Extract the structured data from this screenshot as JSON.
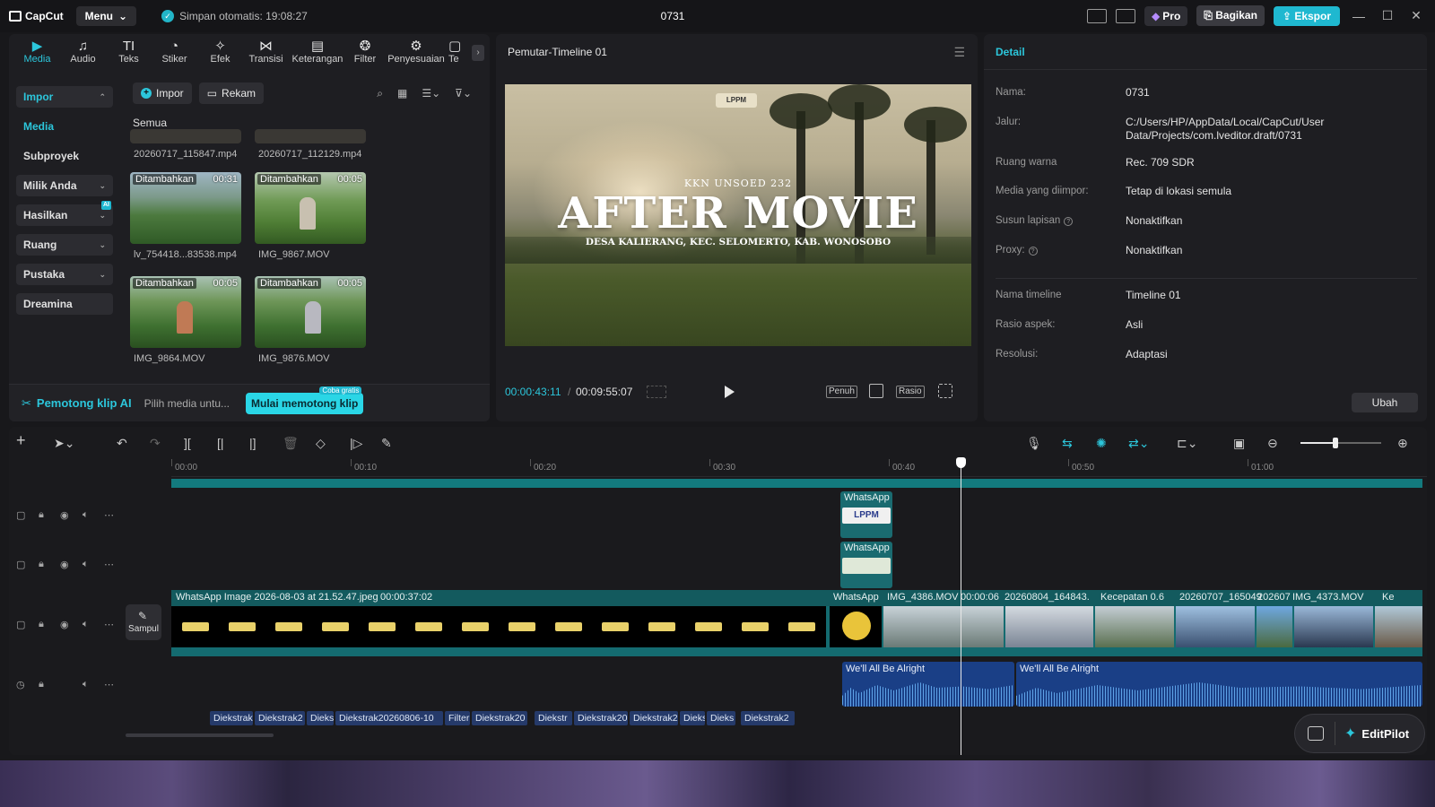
{
  "app": {
    "brand": "CapCut",
    "menu_label": "Menu",
    "autosave": "Simpan otomatis: 19:08:27",
    "project_title": "0731",
    "pro_label": "Pro",
    "share_label": "Bagikan",
    "export_label": "Ekspor"
  },
  "tool_tabs": [
    {
      "label": "Media",
      "icon": "media-icon"
    },
    {
      "label": "Audio",
      "icon": "audio-icon"
    },
    {
      "label": "Teks",
      "icon": "text-icon"
    },
    {
      "label": "Stiker",
      "icon": "sticker-icon"
    },
    {
      "label": "Efek",
      "icon": "effect-icon"
    },
    {
      "label": "Transisi",
      "icon": "transition-icon"
    },
    {
      "label": "Keterangan",
      "icon": "caption-icon"
    },
    {
      "label": "Filter",
      "icon": "filter-icon"
    },
    {
      "label": "Penyesuaian",
      "icon": "adjust-icon"
    },
    {
      "label": "Te",
      "icon": "template-icon"
    }
  ],
  "side_nav": {
    "impor": "Impor",
    "media": "Media",
    "subproyek": "Subproyek",
    "milik_anda": "Milik Anda",
    "hasilkan": "Hasilkan",
    "ai_badge": "AI",
    "ruang": "Ruang",
    "pustaka": "Pustaka",
    "dreamina": "Dreamina"
  },
  "media_toolbar": {
    "import_label": "Impor",
    "record_label": "Rekam"
  },
  "media": {
    "filter_label": "Semua",
    "items": [
      {
        "name": "20260717_115847.mp4",
        "added": "",
        "duration": ""
      },
      {
        "name": "20260717_112129.mp4",
        "added": "",
        "duration": ""
      },
      {
        "name": "lv_754418...83538.mp4",
        "added": "Ditambahkan",
        "duration": "00:31"
      },
      {
        "name": "IMG_9867.MOV",
        "added": "Ditambahkan",
        "duration": "00:05"
      },
      {
        "name": "IMG_9864.MOV",
        "added": "Ditambahkan",
        "duration": "00:05"
      },
      {
        "name": "IMG_9876.MOV",
        "added": "Ditambahkan",
        "duration": "00:05"
      }
    ]
  },
  "ai_bar": {
    "title": "Pemotong klip AI",
    "hint": "Pilih media untu...",
    "start_label": "Mulai memotong klip",
    "try_badge": "Coba gratis"
  },
  "player": {
    "title": "Pemutar-Timeline 01",
    "video_logo": "LPPM",
    "video_kicker": "KKN UNSOED 232",
    "video_title": "AFTER MOVIE",
    "video_subtitle": "DESA KALIERANG, KEC. SELOMERTO, KAB. WONOSOBO",
    "current_time": "00:00:43:11",
    "separator": "/",
    "total_time": "00:09:55:07",
    "full_label": "Penuh",
    "ratio_label": "Rasio"
  },
  "detail": {
    "header": "Detail",
    "rows": [
      {
        "label": "Nama:",
        "value": "0731"
      },
      {
        "label": "Jalur:",
        "value": "C:/Users/HP/AppData/Local/CapCut/User Data/Projects/com.lveditor.draft/0731"
      },
      {
        "label": "Ruang warna",
        "value": "Rec. 709 SDR"
      },
      {
        "label": "Media yang diimpor:",
        "value": "Tetap di lokasi semula"
      },
      {
        "label": "Susun lapisan",
        "value": "Nonaktifkan"
      },
      {
        "label": "Proxy:",
        "value": "Nonaktifkan"
      },
      {
        "label": "Nama timeline",
        "value": "Timeline 01"
      },
      {
        "label": "Rasio aspek:",
        "value": "Asli"
      },
      {
        "label": "Resolusi:",
        "value": "Adaptasi"
      }
    ],
    "edit_label": "Ubah"
  },
  "timeline": {
    "ruler": [
      "00:00",
      "00:10",
      "00:20",
      "00:30",
      "00:40",
      "00:50",
      "01:00"
    ],
    "overlay_clip_1": "WhatsApp",
    "overlay_clip_1_thumb": "LPPM",
    "overlay_clip_2": "WhatsApp",
    "main_clip_name": "WhatsApp Image 2026-08-03 at 21.52.47.jpeg",
    "main_clip_duration": "00:00:37:02",
    "main_segments": [
      {
        "label": "WhatsApp"
      },
      {
        "label": "IMG_4386.MOV"
      },
      {
        "label": "00:00:06"
      },
      {
        "label": "20260804_164843."
      },
      {
        "label": "Kecepatan 0.6"
      },
      {
        "label": "20260707_165049"
      },
      {
        "label": "202607"
      },
      {
        "label": "IMG_4373.MOV"
      },
      {
        "label": "Ke"
      }
    ],
    "cover_label": "Sampul",
    "audio_clips": [
      "We'll All Be Alright",
      "We'll All Be Alright"
    ],
    "fx_clips": [
      "Diekstrak",
      "Diekstrak2",
      "Dieks",
      "Diekstrak20260806-10",
      "Filter",
      "Diekstrak20",
      "Diekstr",
      "Diekstrak20",
      "Diekstrak2",
      "Dieks",
      "Dieks",
      "Diekstrak2"
    ]
  },
  "editpilot": {
    "label": "EditPilot"
  },
  "colors": {
    "accent": "#2cc6db",
    "video_clip": "#146b70",
    "audio_clip": "#1a3f86"
  }
}
